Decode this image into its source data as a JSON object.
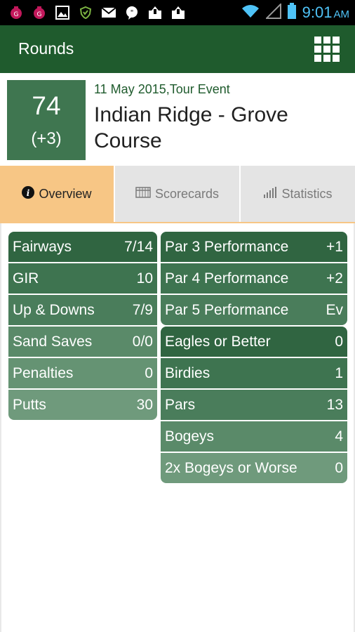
{
  "status_bar": {
    "icons": [
      "app-icon",
      "app-icon-2",
      "image-icon",
      "shield-icon",
      "mail-icon",
      "chat-icon",
      "upload-icon",
      "upload-icon-2"
    ],
    "time": "9:01",
    "ampm": "AM"
  },
  "action_bar": {
    "title": "Rounds",
    "menu_icon": "grid-icon"
  },
  "round": {
    "score": "74",
    "to_par": "(+3)",
    "date_event": "11 May 2015,Tour Event",
    "course": "Indian Ridge - Grove Course"
  },
  "tabs": [
    {
      "label": "Overview",
      "icon": "info-icon",
      "active": true
    },
    {
      "label": "Scorecards",
      "icon": "scorecard-icon",
      "active": false
    },
    {
      "label": "Statistics",
      "icon": "bar-chart-icon",
      "active": false
    }
  ],
  "left_stats": [
    {
      "label": "Fairways",
      "value": "7/14"
    },
    {
      "label": "GIR",
      "value": "10"
    },
    {
      "label": "Up & Downs",
      "value": "7/9"
    },
    {
      "label": "Sand Saves",
      "value": "0/0"
    },
    {
      "label": "Penalties",
      "value": "0"
    },
    {
      "label": "Putts",
      "value": "30"
    }
  ],
  "par_stats": [
    {
      "label": "Par 3 Performance",
      "value": "+1"
    },
    {
      "label": "Par 4 Performance",
      "value": "+2"
    },
    {
      "label": "Par 5 Performance",
      "value": "Ev"
    }
  ],
  "score_stats": [
    {
      "label": "Eagles or Better",
      "value": "0"
    },
    {
      "label": "Birdies",
      "value": "1"
    },
    {
      "label": "Pars",
      "value": "13"
    },
    {
      "label": "Bogeys",
      "value": "4"
    },
    {
      "label": "2x Bogeys or Worse",
      "value": "0"
    }
  ],
  "colors": {
    "primary": "#1f5b2d",
    "active_tab": "#f7c685",
    "inactive_tab": "#e4e4e4",
    "clock": "#4fc3f7"
  }
}
